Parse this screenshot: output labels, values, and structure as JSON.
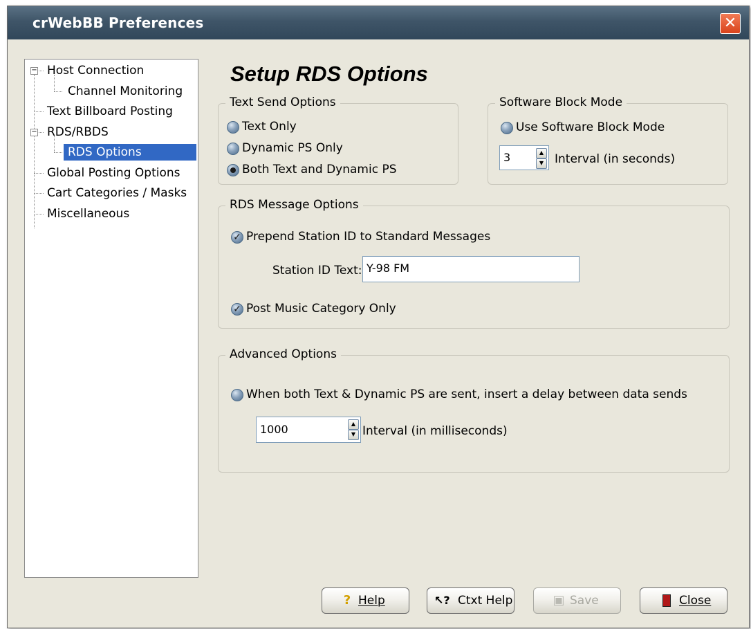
{
  "window": {
    "title": "crWebBB Preferences"
  },
  "tree": {
    "items": [
      {
        "label": "Host Connection",
        "expander": "⊟"
      },
      {
        "label": "Channel Monitoring"
      },
      {
        "label": "Text Billboard Posting"
      },
      {
        "label": "RDS/RBDS",
        "expander": "⊟"
      },
      {
        "label": "RDS Options",
        "selected": true
      },
      {
        "label": "Global Posting Options"
      },
      {
        "label": "Cart Categories / Masks"
      },
      {
        "label": "Miscellaneous"
      }
    ]
  },
  "page": {
    "heading": "Setup RDS Options"
  },
  "text_send": {
    "legend": "Text Send Options",
    "options": [
      "Text Only",
      "Dynamic PS Only",
      "Both Text and Dynamic PS"
    ],
    "selected": "Both Text and Dynamic PS"
  },
  "block_mode": {
    "legend": "Software Block Mode",
    "checkbox_label": "Use Software Block Mode",
    "interval_value": "3",
    "interval_label": "Interval (in seconds)"
  },
  "rds_message": {
    "legend": "RDS Message Options",
    "prepend_label": "Prepend Station ID to Standard Messages",
    "station_id_label": "Station ID Text:",
    "station_id_value": "Y-98 FM",
    "post_music_label": "Post Music Category Only"
  },
  "advanced": {
    "legend": "Advanced Options",
    "delay_label": "When both Text & Dynamic PS are sent, insert a delay between data sends",
    "interval_value": "1000",
    "interval_label": "Interval (in milliseconds)"
  },
  "buttons": {
    "help": "Help",
    "ctxt_help": "Ctxt Help",
    "save": "Save",
    "close": "Close"
  },
  "icons": {
    "title_close": "close-x-icon",
    "help": "question-mark-icon",
    "ctxt_help": "arrow-question-icon",
    "save": "save-disk-icon",
    "close": "door-exit-icon"
  }
}
